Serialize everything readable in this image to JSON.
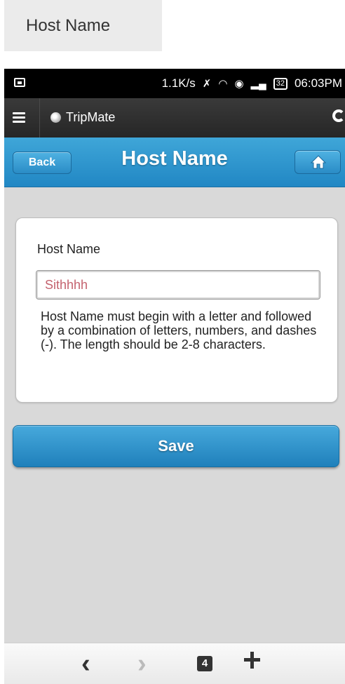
{
  "caption": {
    "text": "Host Name"
  },
  "statusbar": {
    "speed": "1.1K/s",
    "battery": "32",
    "time": "06:03PM",
    "icons": [
      "image-icon",
      "mute-icon",
      "wifi-icon",
      "bluetooth-icon",
      "signal-icon",
      "battery-icon"
    ]
  },
  "appbar": {
    "title": "TripMate",
    "icons": [
      "menu-icon",
      "app-logo-icon",
      "refresh-icon"
    ]
  },
  "header": {
    "title": "Host Name",
    "back_label": "Back",
    "home_icon": "home-icon"
  },
  "form": {
    "label": "Host Name",
    "value": "Sithhhh",
    "hint": "Host Name must begin with a letter and followed by a combination of letters, numbers, and dashes (-). The length should be 2-8 characters."
  },
  "save_label": "Save",
  "bottombar": {
    "back_glyph": "‹",
    "forward_glyph": "›",
    "tab_count": "4",
    "icons": [
      "chevron-left-icon",
      "chevron-right-icon",
      "tabs-icon",
      "plus-icon"
    ]
  },
  "colors": {
    "accent": "#2a92ce",
    "input_text": "#c4626e",
    "background": "#d9d9d9"
  }
}
